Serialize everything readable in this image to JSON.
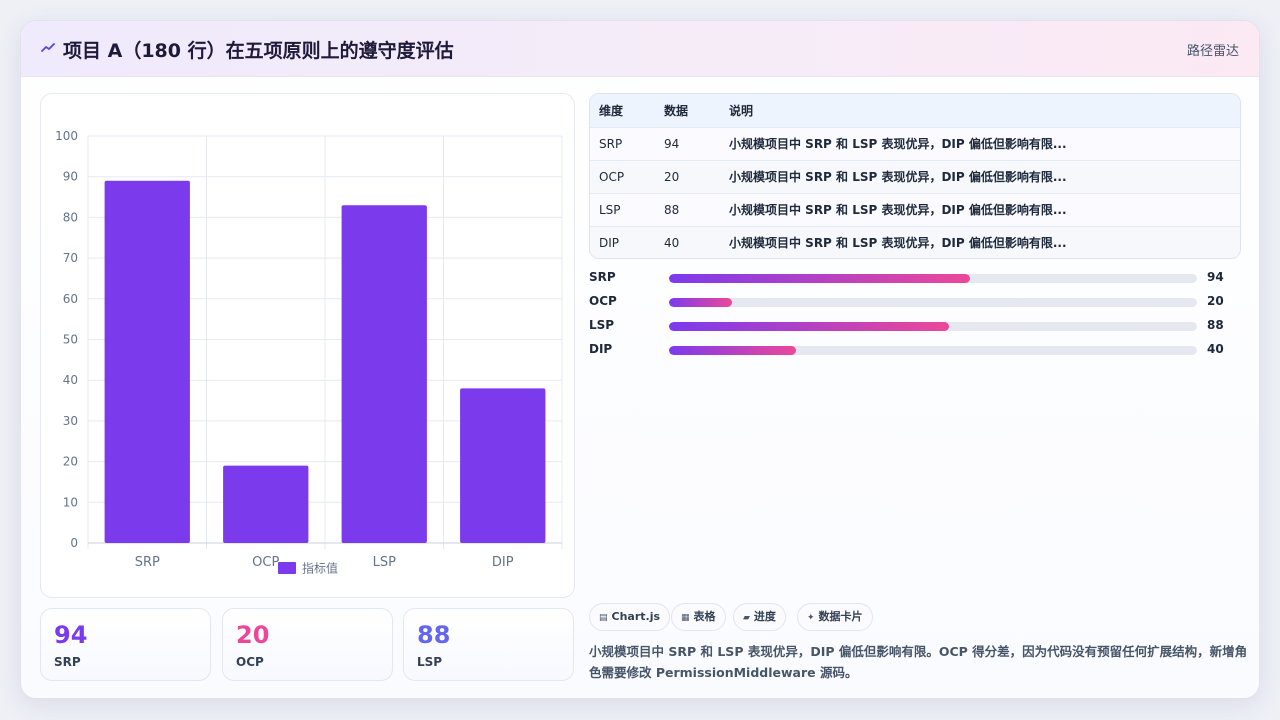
{
  "header": {
    "title": "项目 A（180 行）在五项原则上的遵守度评估",
    "tag": "路径雷达",
    "accent": "#4f46e5"
  },
  "chart_data": {
    "type": "bar",
    "categories": [
      "SRP",
      "OCP",
      "LSP",
      "DIP"
    ],
    "series": [
      {
        "name": "指标值",
        "values": [
          89,
          19,
          83,
          38
        ],
        "color": "#7c3aed"
      }
    ],
    "ylim": [
      0,
      100
    ],
    "yticks": [
      0,
      10,
      20,
      30,
      40,
      50,
      60,
      70,
      80,
      90,
      100
    ],
    "grid": true,
    "legend": "bottom"
  },
  "table": {
    "headers": [
      "维度",
      "数据",
      "说明"
    ],
    "rows": [
      [
        "SRP",
        "94",
        "小规模项目中 SRP 和 LSP 表现优异，DIP 偏低但影响有限..."
      ],
      [
        "OCP",
        "20",
        "小规模项目中 SRP 和 LSP 表现优异，DIP 偏低但影响有限..."
      ],
      [
        "LSP",
        "88",
        "小规模项目中 SRP 和 LSP 表现优异，DIP 偏低但影响有限..."
      ],
      [
        "DIP",
        "40",
        "小规模项目中 SRP 和 LSP 表现优异，DIP 偏低但影响有限..."
      ]
    ]
  },
  "progress": [
    {
      "label": "SRP",
      "value": 94,
      "fill_percent": 57
    },
    {
      "label": "OCP",
      "value": 20,
      "fill_percent": 12
    },
    {
      "label": "LSP",
      "value": 88,
      "fill_percent": 53
    },
    {
      "label": "DIP",
      "value": 40,
      "fill_percent": 24
    }
  ],
  "kpis": [
    {
      "value": "94",
      "label": "SRP",
      "color": "#7c3aed"
    },
    {
      "value": "20",
      "label": "OCP",
      "color": "#ec4899"
    },
    {
      "value": "88",
      "label": "LSP",
      "color": "#6366f1"
    }
  ],
  "chips": [
    {
      "icon": "chart-icon",
      "glyph": "▤",
      "label": "Chart.js"
    },
    {
      "icon": "table-icon",
      "glyph": "▦",
      "label": "表格"
    },
    {
      "icon": "progress-icon",
      "glyph": "▰",
      "label": "进度"
    },
    {
      "icon": "sparkle-icon",
      "glyph": "✦",
      "label": "数据卡片"
    }
  ],
  "summary": "小规模项目中 SRP 和 LSP 表现优异，DIP 偏低但影响有限。OCP 得分差，因为代码没有预留任何扩展结构，新增角色需要修改 PermissionMiddleware 源码。"
}
